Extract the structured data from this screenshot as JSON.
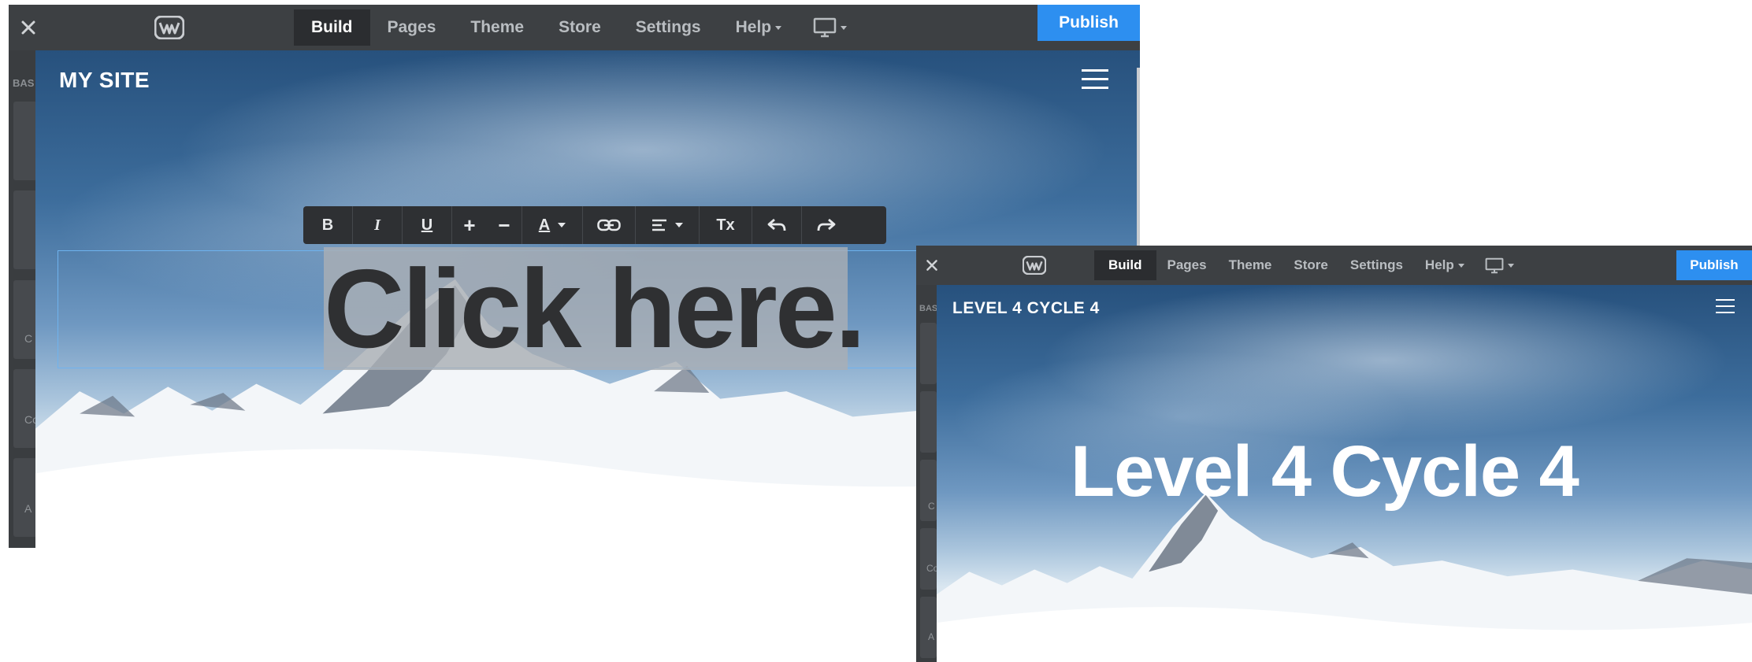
{
  "editor": {
    "close_icon": "close-icon",
    "logo_icon": "weebly-logo-icon",
    "nav": [
      {
        "label": "Build",
        "active": true
      },
      {
        "label": "Pages"
      },
      {
        "label": "Theme"
      },
      {
        "label": "Store"
      },
      {
        "label": "Settings"
      },
      {
        "label": "Help",
        "dropdown": true
      }
    ],
    "device_icon": "desktop-icon",
    "publish_label": "Publish",
    "accent_color": "#2d8ff0"
  },
  "sidebar": {
    "section_label": "BAS",
    "tile_labels": [
      "C",
      "A",
      "Co",
      "A"
    ],
    "tile_labels_b": [
      "C",
      "Co",
      "A"
    ]
  },
  "screenshot_a": {
    "site_title": "MY SITE",
    "headline": "Click here.",
    "toolbar": [
      {
        "name": "bold-button",
        "label": "B"
      },
      {
        "name": "italic-button",
        "label": "I"
      },
      {
        "name": "underline-button",
        "label": "U"
      },
      {
        "name": "increase-size-button",
        "label": "+"
      },
      {
        "name": "decrease-size-button",
        "label": "−"
      },
      {
        "name": "text-color-button",
        "label": "A"
      },
      {
        "name": "link-button",
        "icon": "link-icon"
      },
      {
        "name": "align-button",
        "icon": "align-left-icon"
      },
      {
        "name": "clear-format-button",
        "label": "Tx"
      },
      {
        "name": "undo-button",
        "icon": "undo-icon"
      },
      {
        "name": "redo-button",
        "icon": "redo-icon"
      }
    ]
  },
  "screenshot_b": {
    "site_title": "LEVEL 4 CYCLE 4",
    "headline": "Level 4 Cycle 4"
  }
}
